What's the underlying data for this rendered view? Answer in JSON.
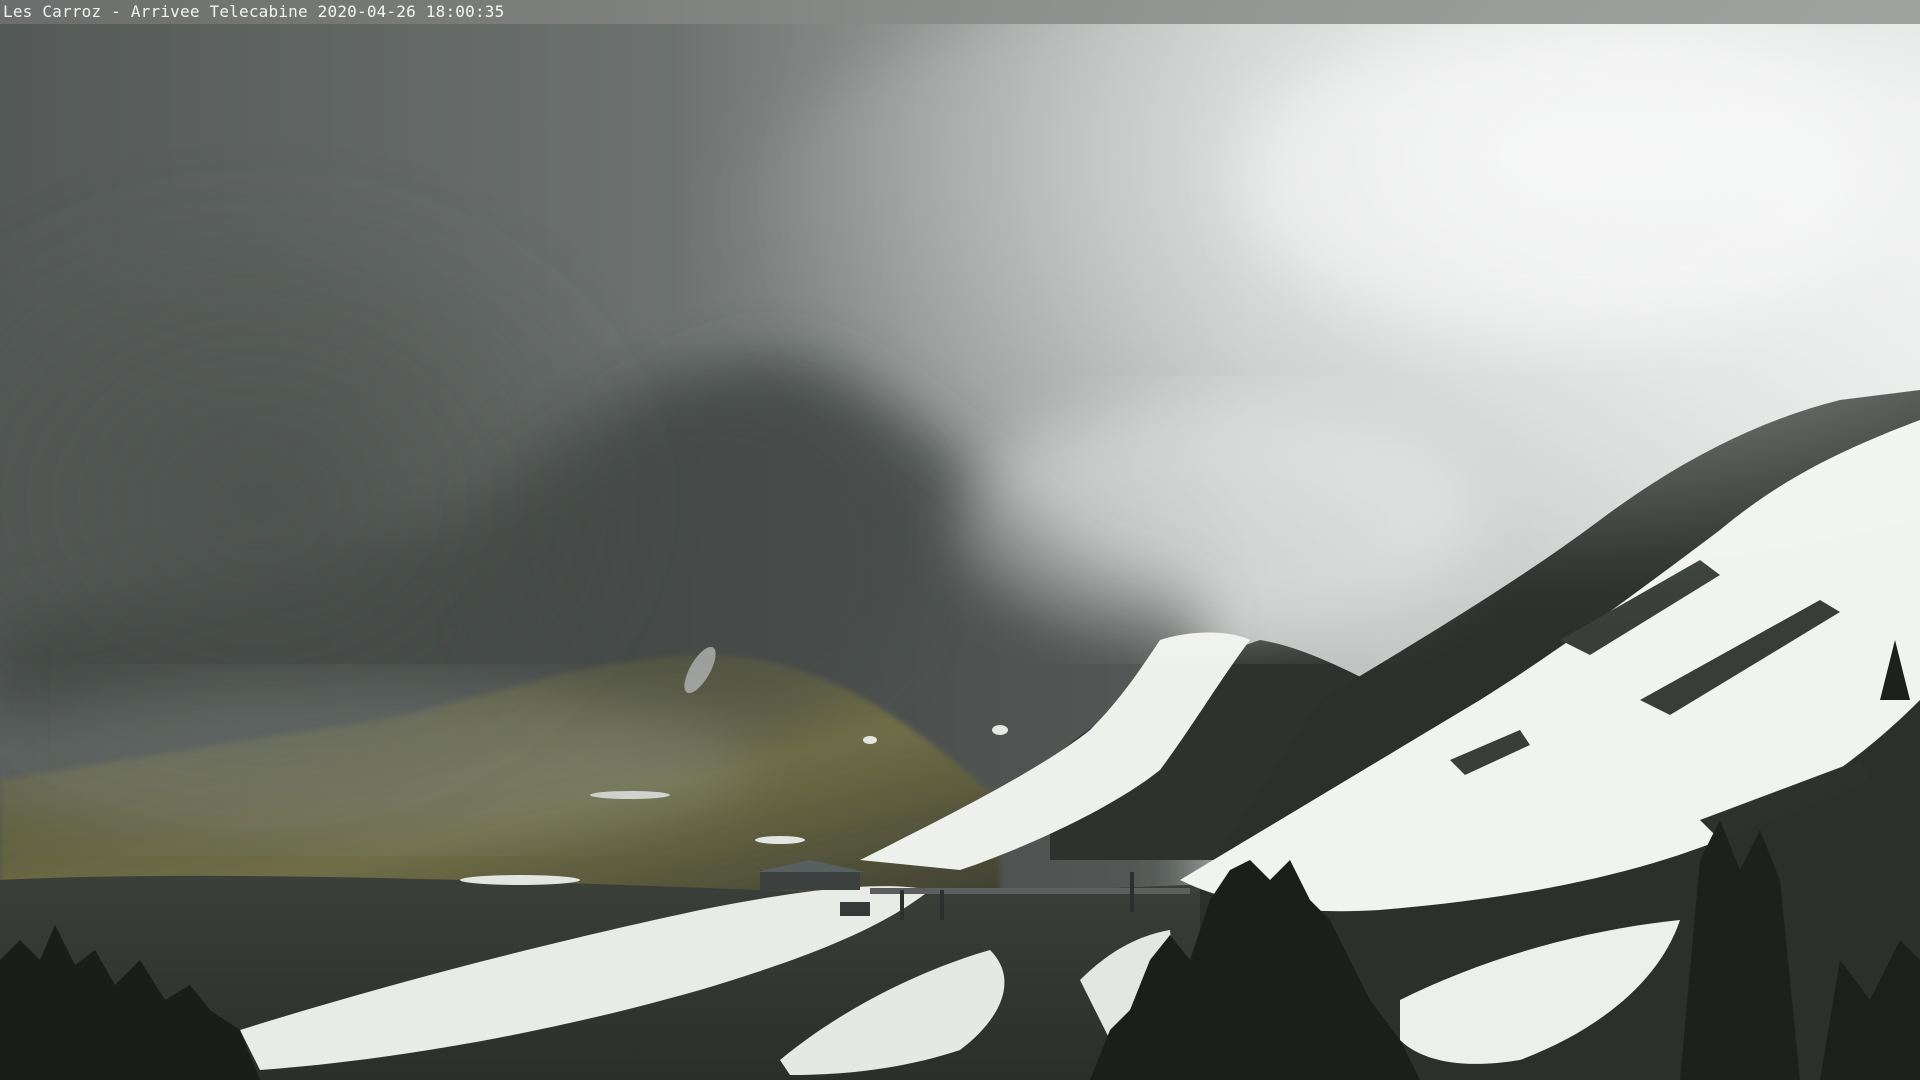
{
  "overlay": {
    "caption": "Les Carroz - Arrivee Telecabine 2020-04-26 18:00:35"
  },
  "colors": {
    "fog": "#d9dcda",
    "dark_fog": "#5c605e",
    "snow": "#f3f5f2",
    "rock": "#2a2d2a",
    "grass": "#6b6a45",
    "forest": "#1a1e1b"
  }
}
